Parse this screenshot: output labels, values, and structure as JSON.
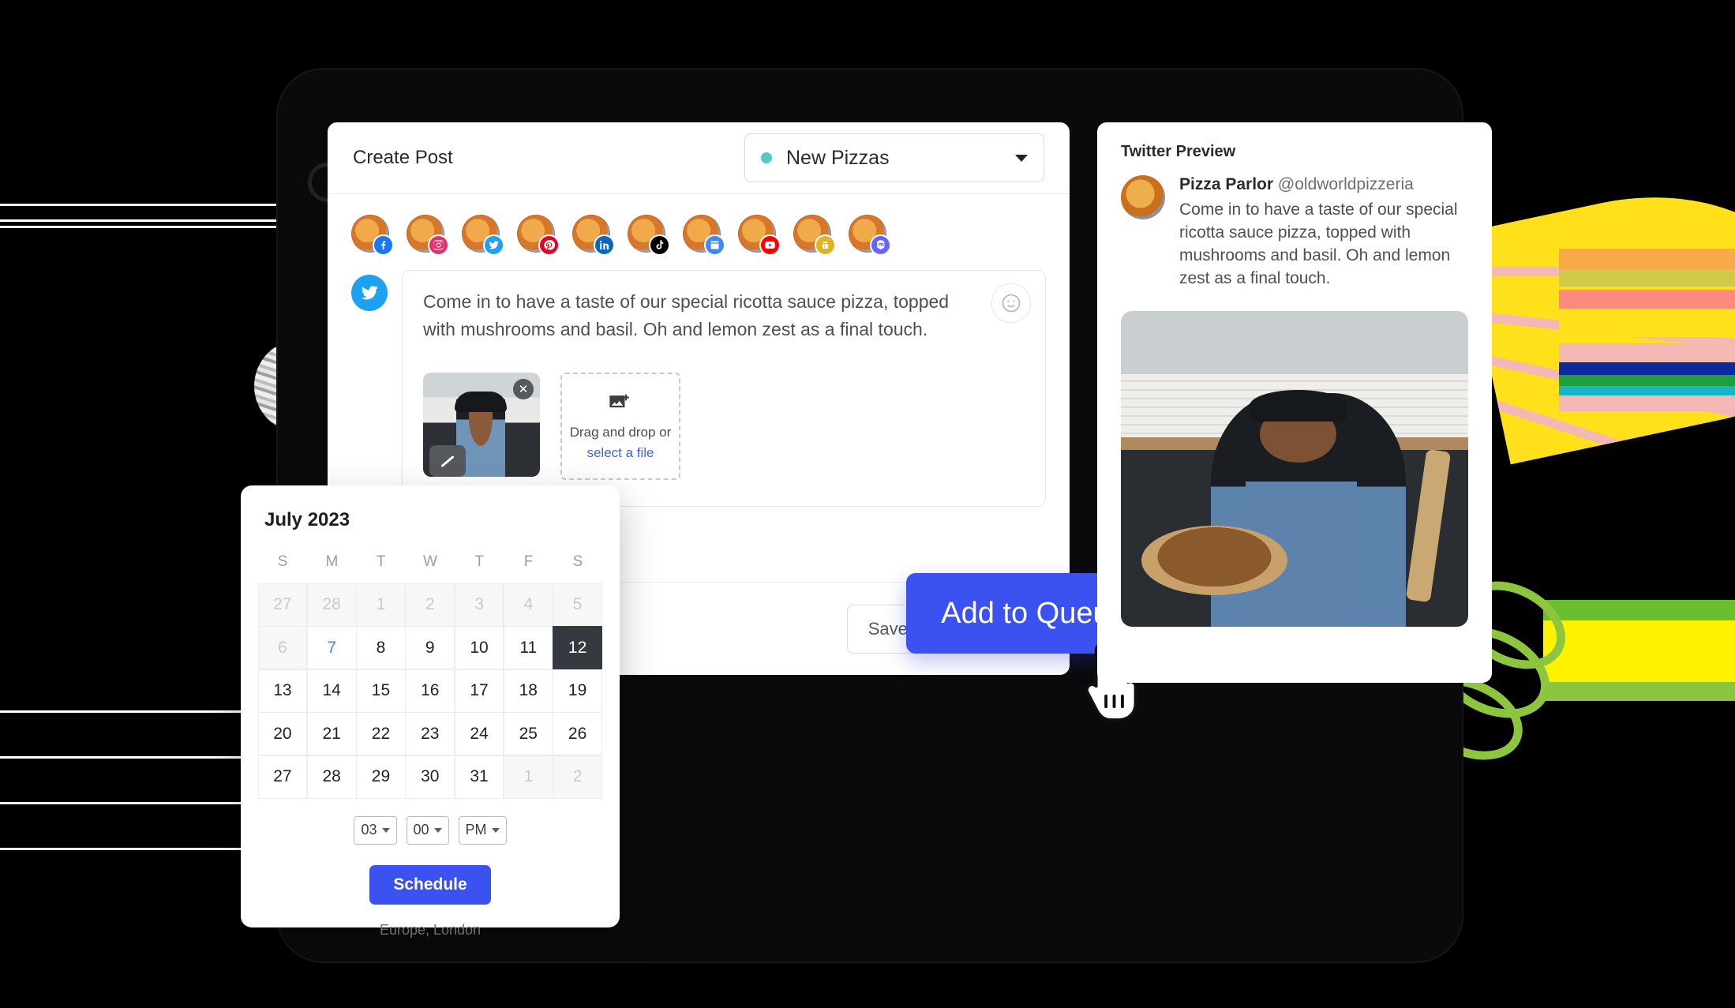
{
  "app": {
    "header": {
      "title": "Create Post",
      "campaign": {
        "label": "New Pizzas",
        "dot_color": "#4ECDC4",
        "caret": "chevron-down-icon"
      }
    },
    "accounts": [
      {
        "name": "facebook",
        "icon": "facebook-icon",
        "color": "#1877F2"
      },
      {
        "name": "instagram",
        "icon": "instagram-icon",
        "color": "#E1306C"
      },
      {
        "name": "twitter",
        "icon": "twitter-icon",
        "color": "#1DA1F2"
      },
      {
        "name": "pinterest",
        "icon": "pinterest-icon",
        "color": "#E60023"
      },
      {
        "name": "linkedin",
        "icon": "linkedin-icon",
        "color": "#0A66C2"
      },
      {
        "name": "tiktok",
        "icon": "tiktok-icon",
        "color": "#000000"
      },
      {
        "name": "google-business",
        "icon": "google-business-icon",
        "color": "#4285F4"
      },
      {
        "name": "youtube",
        "icon": "youtube-icon",
        "color": "#FF0000"
      },
      {
        "name": "shopify",
        "icon": "shopify-icon",
        "color": "#E0B322"
      },
      {
        "name": "mastodon",
        "icon": "mastodon-icon",
        "color": "#6364FF"
      }
    ],
    "composer": {
      "network": "twitter",
      "text": "Come in to have a taste of our special ricotta sauce pizza, topped with mushrooms and basil. Oh and lemon zest as a final touch.",
      "emoji_button": "emoji-icon",
      "attachment": {
        "remove_label": "✕",
        "alt": "pizza-chef-thumbnail"
      },
      "dropzone": {
        "icon": "add-image-icon",
        "line1": "Drag and drop or",
        "line2": "select a file"
      }
    },
    "actions": {
      "draft_label": "Save as Draft",
      "draft_caret": "chevron-down-icon",
      "queue_label": "Add to Queue",
      "queue_caret": "chevron-down-icon",
      "queue_color": "#3B51F0"
    }
  },
  "preview": {
    "title": "Twitter Preview",
    "account_name": "Pizza Parlor",
    "account_handle": "@oldworldpizzeria",
    "text": "Come in to have a taste of our special ricotta sauce pizza, topped with mushrooms and basil. Oh and lemon zest as a final touch.",
    "image_alt": "pizza-chef-photo"
  },
  "calendar": {
    "title": "July 2023",
    "dow": [
      "S",
      "M",
      "T",
      "W",
      "T",
      "F",
      "S"
    ],
    "weeks": [
      [
        {
          "d": "27",
          "state": "mute"
        },
        {
          "d": "28",
          "state": "mute"
        },
        {
          "d": "1",
          "state": "mute"
        },
        {
          "d": "2",
          "state": "mute"
        },
        {
          "d": "3",
          "state": "mute"
        },
        {
          "d": "4",
          "state": "mute"
        },
        {
          "d": "5",
          "state": "mute"
        }
      ],
      [
        {
          "d": "6",
          "state": "mute"
        },
        {
          "d": "7",
          "state": "today"
        },
        {
          "d": "8",
          "state": ""
        },
        {
          "d": "9",
          "state": ""
        },
        {
          "d": "10",
          "state": ""
        },
        {
          "d": "11",
          "state": ""
        },
        {
          "d": "12",
          "state": "sel"
        }
      ],
      [
        {
          "d": "13",
          "state": ""
        },
        {
          "d": "14",
          "state": ""
        },
        {
          "d": "15",
          "state": ""
        },
        {
          "d": "16",
          "state": ""
        },
        {
          "d": "17",
          "state": ""
        },
        {
          "d": "18",
          "state": ""
        },
        {
          "d": "19",
          "state": ""
        }
      ],
      [
        {
          "d": "20",
          "state": ""
        },
        {
          "d": "21",
          "state": ""
        },
        {
          "d": "22",
          "state": ""
        },
        {
          "d": "23",
          "state": ""
        },
        {
          "d": "24",
          "state": ""
        },
        {
          "d": "25",
          "state": ""
        },
        {
          "d": "26",
          "state": ""
        }
      ],
      [
        {
          "d": "27",
          "state": ""
        },
        {
          "d": "28",
          "state": ""
        },
        {
          "d": "29",
          "state": ""
        },
        {
          "d": "30",
          "state": ""
        },
        {
          "d": "31",
          "state": ""
        },
        {
          "d": "1",
          "state": "mute"
        },
        {
          "d": "2",
          "state": "mute"
        }
      ]
    ],
    "time": {
      "hour": "03",
      "minute": "00",
      "meridiem": "PM"
    },
    "schedule_label": "Schedule",
    "timezone": "Europe, London",
    "selected_day": "12",
    "today_day": "7"
  },
  "decor": {
    "stripes_top": [
      "#FFE01A",
      "#F9A84A",
      "#CFCB47",
      "#FF8A80",
      "#F4B9B4"
    ],
    "stripes_bottom": [
      "#6BBF2E",
      "#FFF200",
      "#8CC63E"
    ],
    "vine_color": "#8CC63E"
  }
}
